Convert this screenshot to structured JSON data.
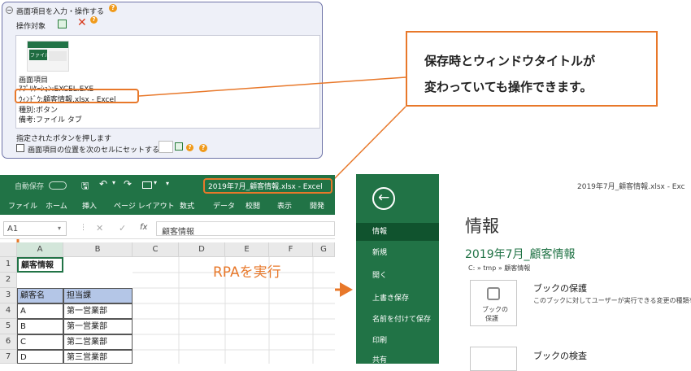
{
  "panel": {
    "title": "画面項目を入力・操作する",
    "target_label": "操作対象",
    "item_heading": "画面項目",
    "application": "ｱﾌﾟﾘｹｰｼｮﾝ:EXCEL.EXE",
    "window": "ｳｨﾝﾄﾞｳ:顧客情報.xlsx - Excel",
    "type": "種別:ボタン",
    "note": "備考:ファイル タブ",
    "action": "指定されたボタンを押します",
    "checkbox_label": "画面項目の位置を次のセルにセットする",
    "thumb_label": "ファイル"
  },
  "callout": {
    "line1": "保存時とウィンドウタイトルが",
    "line2": "変わっていても操作できます。"
  },
  "arrow_label": "RPAを実行",
  "excel_left": {
    "autosave": "自動保存",
    "autosave_state": "オフ",
    "title": "2019年7月_顧客情報.xlsx - Excel",
    "tabs": [
      "ファイル",
      "ホーム",
      "挿入",
      "ページ レイアウト",
      "数式",
      "データ",
      "校閲",
      "表示",
      "開発"
    ],
    "name_box": "A1",
    "formula": "顧客情報",
    "columns": [
      "A",
      "B",
      "C",
      "D",
      "E",
      "F",
      "G"
    ],
    "rows": [
      "1",
      "2",
      "3",
      "4",
      "5",
      "6",
      "7"
    ],
    "cells": {
      "a1": "顧客情報",
      "a3": "顧客名",
      "b3": "担当課",
      "a4": "A",
      "b4": "第一営業部",
      "a5": "B",
      "b5": "第一営業部",
      "a6": "C",
      "b6": "第二営業部",
      "a7": "D",
      "b7": "第三営業部"
    }
  },
  "excel_right": {
    "title": "2019年7月_顧客情報.xlsx - Exc",
    "nav": [
      "情報",
      "新規",
      "開く",
      "上書き保存",
      "名前を付けて保存",
      "印刷",
      "共有"
    ],
    "heading": "情報",
    "filename": "2019年7月_顧客情報",
    "path": "C: » tmp » 顧客情報",
    "protect_title": "ブックの保護",
    "protect_desc": "このブックに対してユーザーが実行できる変更の種類を",
    "protect_btn1": "ブックの",
    "protect_btn2": "保護",
    "inspect_title": "ブックの検査"
  },
  "colors": {
    "excel_green": "#217346",
    "accent_orange": "#e8782a",
    "panel_border": "#6f74a8"
  }
}
